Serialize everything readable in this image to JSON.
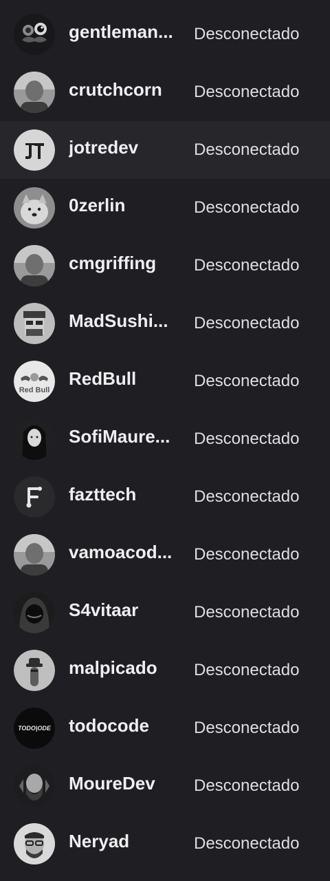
{
  "colors": {
    "background": "#1f1f23",
    "highlight_row": "#26262b",
    "name_text": "#efeff1",
    "status_text": "#dedee3"
  },
  "channels": [
    {
      "name": "gentleman...",
      "status": "Desconectado",
      "avatar": "mustache-glasses-icon"
    },
    {
      "name": "crutchcorn",
      "status": "Desconectado",
      "avatar": "profile-photo"
    },
    {
      "name": "jotredev",
      "status": "Desconectado",
      "avatar": "jt-logo-icon",
      "highlighted": true
    },
    {
      "name": "0zerlin",
      "status": "Desconectado",
      "avatar": "dog-photo"
    },
    {
      "name": "cmgriffing",
      "status": "Desconectado",
      "avatar": "profile-photo"
    },
    {
      "name": "MadSushi...",
      "status": "Desconectado",
      "avatar": "pixel-art-face"
    },
    {
      "name": "RedBull",
      "status": "Desconectado",
      "avatar": "red-bull-logo"
    },
    {
      "name": "SofiMaure...",
      "status": "Desconectado",
      "avatar": "anime-girl-illustration"
    },
    {
      "name": "fazttech",
      "status": "Desconectado",
      "avatar": "fazt-logo-icon"
    },
    {
      "name": "vamoacod...",
      "status": "Desconectado",
      "avatar": "profile-photo"
    },
    {
      "name": "S4vitaar",
      "status": "Desconectado",
      "avatar": "hooded-character-icon"
    },
    {
      "name": "malpicado",
      "status": "Desconectado",
      "avatar": "cartoon-character-icon"
    },
    {
      "name": "todocode",
      "status": "Desconectado",
      "avatar": "todocode-logo"
    },
    {
      "name": "MoureDev",
      "status": "Desconectado",
      "avatar": "bearded-man-photo"
    },
    {
      "name": "Neryad",
      "status": "Desconectado",
      "avatar": "bearded-man-glasses-photo"
    }
  ]
}
